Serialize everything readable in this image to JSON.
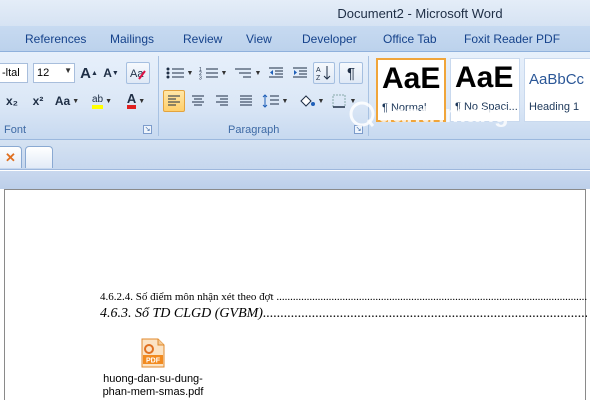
{
  "window": {
    "title": "Document2 - Microsoft Word"
  },
  "ribbon_tabs": [
    {
      "label": "References"
    },
    {
      "label": "Mailings"
    },
    {
      "label": "Review"
    },
    {
      "label": "View"
    },
    {
      "label": "Developer"
    },
    {
      "label": "Office Tab"
    },
    {
      "label": "Foxit Reader PDF"
    }
  ],
  "font_group": {
    "label": "Font",
    "font_name": "-ltal",
    "font_size": "12",
    "grow_label": "A",
    "shrink_label": "A",
    "subscript_label": "x₂",
    "superscript_label": "x²",
    "change_case_label": "Aa",
    "highlight_label": "ab",
    "font_color_label": "A"
  },
  "paragraph_group": {
    "label": "Paragraph",
    "pilcrow": "¶"
  },
  "styles": [
    {
      "sample": "AaE",
      "name": "¶ Normal",
      "selected": true
    },
    {
      "sample": "AaE",
      "name": "¶ No Spaci...",
      "selected": false
    },
    {
      "sample": "AaBbCc",
      "name": "Heading 1",
      "selected": false
    }
  ],
  "watermark": {
    "text": "uantrimang"
  },
  "document": {
    "toc_line_1": "4.6.2.4. Số điểm môn nhận xét theo đợt",
    "toc_line_2": "4.6.3. Sổ TD CLGD (GVBM)",
    "attachment": {
      "file_name_line_1": "huong-dan-su-dung-",
      "file_name_line_2": "phan-mem-smas.pdf",
      "icon_label": "PDF"
    }
  },
  "colors": {
    "accent_orange": "#f0a53a",
    "ribbon_text": "#15428b",
    "font_color_red": "#e02020",
    "highlight_yellow": "#ffff00"
  }
}
